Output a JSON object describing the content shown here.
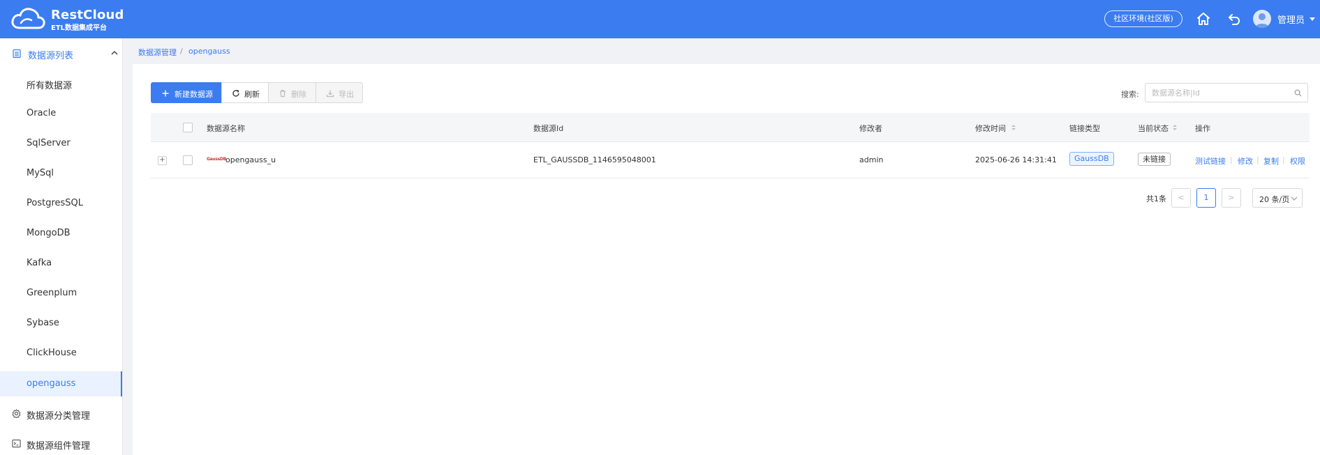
{
  "header": {
    "logo_name": "RestCloud",
    "logo_subtitle": "ETL数据集成平台",
    "env_button": "社区环境(社区版)",
    "user_name": "管理员",
    "icons": [
      "cloud-logo",
      "home-icon",
      "back-icon",
      "user-avatar",
      "caret-down-icon"
    ],
    "brand_color": "#3b7cf0"
  },
  "sidebar": {
    "group_label": "数据源列表",
    "items": [
      {
        "label": "所有数据源"
      },
      {
        "label": "Oracle"
      },
      {
        "label": "SqlServer"
      },
      {
        "label": "MySql"
      },
      {
        "label": "PostgresSQL"
      },
      {
        "label": "MongoDB"
      },
      {
        "label": "Kafka"
      },
      {
        "label": "Greenplum"
      },
      {
        "label": "Sybase"
      },
      {
        "label": "ClickHouse"
      },
      {
        "label": "opengauss",
        "active": true
      }
    ],
    "sections": [
      {
        "label": "数据源分类管理",
        "icon": "gear-icon"
      },
      {
        "label": "数据源组件管理",
        "icon": "terminal-icon"
      }
    ]
  },
  "breadcrumb": {
    "items": [
      "数据源管理",
      "opengauss"
    ],
    "separator": "/"
  },
  "toolbar": {
    "new_label": "新建数据源",
    "refresh_label": "刷新",
    "delete_label": "删除",
    "export_label": "导出"
  },
  "search": {
    "label": "搜索:",
    "placeholder": "数据源名称|Id"
  },
  "table": {
    "columns": [
      "数据源名称",
      "数据源Id",
      "修改者",
      "修改时间",
      "链接类型",
      "当前状态",
      "操作"
    ],
    "rows": [
      {
        "expand": "+",
        "logo_text": "GaussDB",
        "name": "opengauss_u",
        "id": "ETL_GAUSSDB_1146595048001",
        "modifier": "admin",
        "modified_time": "2025-06-26 14:31:41",
        "type": "GaussDB",
        "status": "未链接",
        "actions": [
          "测试链接",
          "修改",
          "复制",
          "权限"
        ]
      }
    ]
  },
  "pagination": {
    "total": "共1条",
    "prev": "<",
    "current": "1",
    "next": ">",
    "page_size": "20 条/页"
  }
}
